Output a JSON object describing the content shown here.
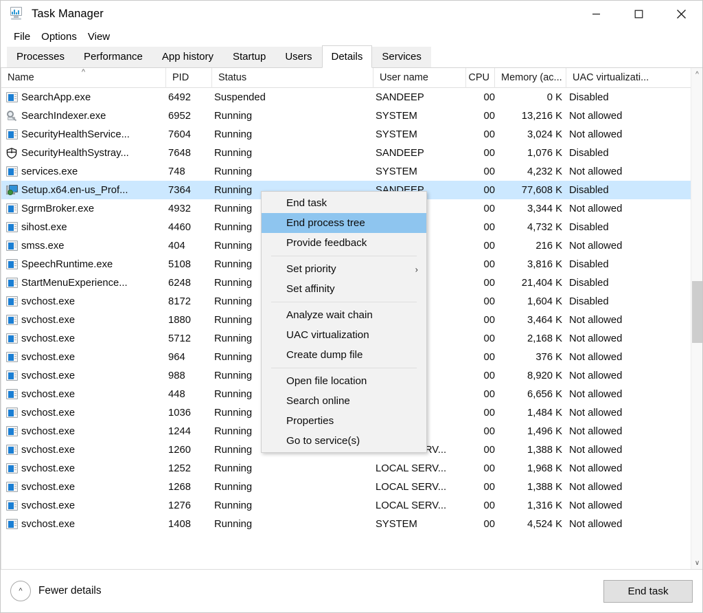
{
  "window": {
    "title": "Task Manager",
    "icon": "taskmanager-monitor-icon",
    "controls": {
      "minimize": "minimize-icon",
      "maximize": "maximize-icon",
      "close": "close-icon"
    }
  },
  "menubar": {
    "items": [
      "File",
      "Options",
      "View"
    ]
  },
  "tabs": {
    "items": [
      "Processes",
      "Performance",
      "App history",
      "Startup",
      "Users",
      "Details",
      "Services"
    ],
    "active": "Details"
  },
  "columns": [
    {
      "key": "name",
      "label": "Name",
      "sorted": "asc"
    },
    {
      "key": "pid",
      "label": "PID"
    },
    {
      "key": "status",
      "label": "Status"
    },
    {
      "key": "user",
      "label": "User name"
    },
    {
      "key": "cpu",
      "label": "CPU"
    },
    {
      "key": "memory",
      "label": "Memory (ac..."
    },
    {
      "key": "uac",
      "label": "UAC virtualizati..."
    }
  ],
  "rows": [
    {
      "icon": "window-icon",
      "name": "SearchApp.exe",
      "pid": "6492",
      "status": "Suspended",
      "user": "SANDEEP",
      "cpu": "00",
      "memory": "0 K",
      "uac": "Disabled",
      "selected": false
    },
    {
      "icon": "search-icon",
      "name": "SearchIndexer.exe",
      "pid": "6952",
      "status": "Running",
      "user": "SYSTEM",
      "cpu": "00",
      "memory": "13,216 K",
      "uac": "Not allowed",
      "selected": false
    },
    {
      "icon": "window-icon",
      "name": "SecurityHealthService...",
      "pid": "7604",
      "status": "Running",
      "user": "SYSTEM",
      "cpu": "00",
      "memory": "3,024 K",
      "uac": "Not allowed",
      "selected": false
    },
    {
      "icon": "shield-icon",
      "name": "SecurityHealthSystray...",
      "pid": "7648",
      "status": "Running",
      "user": "SANDEEP",
      "cpu": "00",
      "memory": "1,076 K",
      "uac": "Disabled",
      "selected": false
    },
    {
      "icon": "window-icon",
      "name": "services.exe",
      "pid": "748",
      "status": "Running",
      "user": "SYSTEM",
      "cpu": "00",
      "memory": "4,232 K",
      "uac": "Not allowed",
      "selected": false
    },
    {
      "icon": "setup-icon",
      "name": "Setup.x64.en-us_Prof...",
      "pid": "7364",
      "status": "Running",
      "user": "SANDEEP",
      "cpu": "00",
      "memory": "77,608 K",
      "uac": "Disabled",
      "selected": true
    },
    {
      "icon": "window-icon",
      "name": "SgrmBroker.exe",
      "pid": "4932",
      "status": "Running",
      "user": "",
      "cpu": "00",
      "memory": "3,344 K",
      "uac": "Not allowed",
      "selected": false
    },
    {
      "icon": "window-icon",
      "name": "sihost.exe",
      "pid": "4460",
      "status": "Running",
      "user": "",
      "cpu": "00",
      "memory": "4,732 K",
      "uac": "Disabled",
      "selected": false
    },
    {
      "icon": "window-icon",
      "name": "smss.exe",
      "pid": "404",
      "status": "Running",
      "user": "",
      "cpu": "00",
      "memory": "216 K",
      "uac": "Not allowed",
      "selected": false
    },
    {
      "icon": "window-icon",
      "name": "SpeechRuntime.exe",
      "pid": "5108",
      "status": "Running",
      "user": "",
      "cpu": "00",
      "memory": "3,816 K",
      "uac": "Disabled",
      "selected": false
    },
    {
      "icon": "window-icon",
      "name": "StartMenuExperience...",
      "pid": "6248",
      "status": "Running",
      "user": "",
      "cpu": "00",
      "memory": "21,404 K",
      "uac": "Disabled",
      "selected": false
    },
    {
      "icon": "window-icon",
      "name": "svchost.exe",
      "pid": "8172",
      "status": "Running",
      "user": "",
      "cpu": "00",
      "memory": "1,604 K",
      "uac": "Disabled",
      "selected": false
    },
    {
      "icon": "window-icon",
      "name": "svchost.exe",
      "pid": "1880",
      "status": "Running",
      "user": "",
      "cpu": "00",
      "memory": "3,464 K",
      "uac": "Not allowed",
      "selected": false
    },
    {
      "icon": "window-icon",
      "name": "svchost.exe",
      "pid": "5712",
      "status": "Running",
      "user": "",
      "cpu": "00",
      "memory": "2,168 K",
      "uac": "Not allowed",
      "selected": false
    },
    {
      "icon": "window-icon",
      "name": "svchost.exe",
      "pid": "964",
      "status": "Running",
      "user": "",
      "cpu": "00",
      "memory": "376 K",
      "uac": "Not allowed",
      "selected": false
    },
    {
      "icon": "window-icon",
      "name": "svchost.exe",
      "pid": "988",
      "status": "Running",
      "user": "",
      "cpu": "00",
      "memory": "8,920 K",
      "uac": "Not allowed",
      "selected": false
    },
    {
      "icon": "window-icon",
      "name": "svchost.exe",
      "pid": "448",
      "status": "Running",
      "user": "",
      "cpu": "00",
      "memory": "6,656 K",
      "uac": "Not allowed",
      "selected": false
    },
    {
      "icon": "window-icon",
      "name": "svchost.exe",
      "pid": "1036",
      "status": "Running",
      "user": "",
      "cpu": "00",
      "memory": "1,484 K",
      "uac": "Not allowed",
      "selected": false
    },
    {
      "icon": "window-icon",
      "name": "svchost.exe",
      "pid": "1244",
      "status": "Running",
      "user": "",
      "cpu": "00",
      "memory": "1,496 K",
      "uac": "Not allowed",
      "selected": false
    },
    {
      "icon": "window-icon",
      "name": "svchost.exe",
      "pid": "1260",
      "status": "Running",
      "user": "LOCAL SERV...",
      "cpu": "00",
      "memory": "1,388 K",
      "uac": "Not allowed",
      "selected": false
    },
    {
      "icon": "window-icon",
      "name": "svchost.exe",
      "pid": "1252",
      "status": "Running",
      "user": "LOCAL SERV...",
      "cpu": "00",
      "memory": "1,968 K",
      "uac": "Not allowed",
      "selected": false
    },
    {
      "icon": "window-icon",
      "name": "svchost.exe",
      "pid": "1268",
      "status": "Running",
      "user": "LOCAL SERV...",
      "cpu": "00",
      "memory": "1,388 K",
      "uac": "Not allowed",
      "selected": false
    },
    {
      "icon": "window-icon",
      "name": "svchost.exe",
      "pid": "1276",
      "status": "Running",
      "user": "LOCAL SERV...",
      "cpu": "00",
      "memory": "1,316 K",
      "uac": "Not allowed",
      "selected": false
    },
    {
      "icon": "window-icon",
      "name": "svchost.exe",
      "pid": "1408",
      "status": "Running",
      "user": "SYSTEM",
      "cpu": "00",
      "memory": "4,524 K",
      "uac": "Not allowed",
      "selected": false
    }
  ],
  "context_menu": {
    "items": [
      {
        "label": "End task",
        "highlighted": false,
        "submenu": false
      },
      {
        "label": "End process tree",
        "highlighted": true,
        "submenu": false
      },
      {
        "label": "Provide feedback",
        "highlighted": false,
        "submenu": false
      },
      {
        "separator": true
      },
      {
        "label": "Set priority",
        "highlighted": false,
        "submenu": true
      },
      {
        "label": "Set affinity",
        "highlighted": false,
        "submenu": false
      },
      {
        "separator": true
      },
      {
        "label": "Analyze wait chain",
        "highlighted": false,
        "submenu": false
      },
      {
        "label": "UAC virtualization",
        "highlighted": false,
        "submenu": false
      },
      {
        "label": "Create dump file",
        "highlighted": false,
        "submenu": false
      },
      {
        "separator": true
      },
      {
        "label": "Open file location",
        "highlighted": false,
        "submenu": false
      },
      {
        "label": "Search online",
        "highlighted": false,
        "submenu": false
      },
      {
        "label": "Properties",
        "highlighted": false,
        "submenu": false
      },
      {
        "label": "Go to service(s)",
        "highlighted": false,
        "submenu": false
      }
    ]
  },
  "bottombar": {
    "fewer_details_label": "Fewer details",
    "fewer_details_icon": "chevron-up-circle-icon",
    "end_task_label": "End task"
  },
  "colors": {
    "selection": "#cce8ff",
    "menu_highlight": "#8ec5ef",
    "window_bg": "#ffffff",
    "menu_bg": "#f2f2f2",
    "tab_inactive": "#f0f0f0",
    "button_face": "#e1e1e1"
  }
}
